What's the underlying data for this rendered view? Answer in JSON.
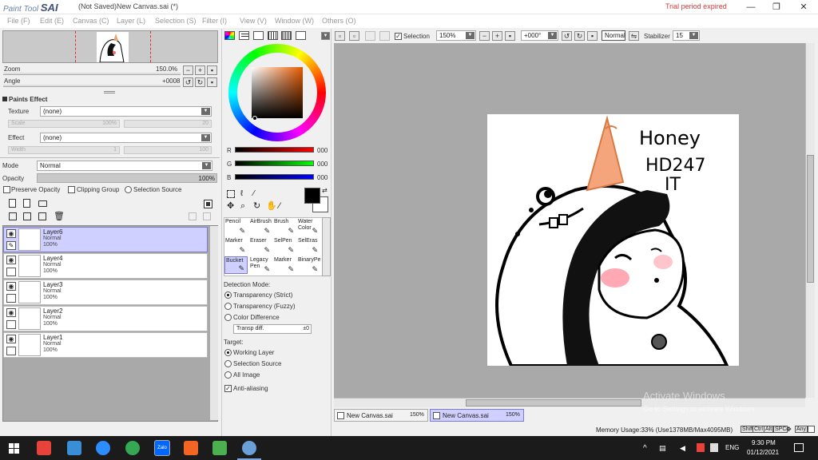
{
  "app": {
    "logo_small": "Paint Tool",
    "logo_big": "SAI",
    "title": "(Not Saved)New Canvas.sai (*)",
    "trial": "Trial period expired"
  },
  "window_controls": [
    "—",
    "❐",
    "✕"
  ],
  "menu": [
    "File (F)",
    "Edit (E)",
    "Canvas (C)",
    "Layer (L)",
    "Selection (S)",
    "Filter (I)",
    "View (V)",
    "Window (W)",
    "Others (O)"
  ],
  "navigator": {
    "zoom_label": "Zoom",
    "zoom_value": "150.0%",
    "angle_label": "Angle",
    "angle_value": "+0008"
  },
  "paints_effect": {
    "header": "Paints Effect",
    "texture_label": "Texture",
    "texture_value": "(none)",
    "scale_label": "Scale",
    "scale_value": "100%",
    "scale_right": "20",
    "effect_label": "Effect",
    "effect_value": "(none)",
    "width_label": "Width",
    "width_value": "1",
    "width_right": "100"
  },
  "layer_props": {
    "mode_label": "Mode",
    "mode_value": "Normal",
    "opacity_label": "Opacity",
    "opacity_value": "100%",
    "opacity_level": 1.0,
    "preserve_opacity": "Preserve Opacity",
    "clipping_group": "Clipping Group",
    "selection_source": "Selection Source"
  },
  "layers": [
    {
      "name": "Layer6",
      "mode": "Normal",
      "opacity": "100%",
      "selected": true
    },
    {
      "name": "Layer4",
      "mode": "Normal",
      "opacity": "100%",
      "selected": false
    },
    {
      "name": "Layer3",
      "mode": "Normal",
      "opacity": "100%",
      "selected": false
    },
    {
      "name": "Layer2",
      "mode": "Normal",
      "opacity": "100%",
      "selected": false
    },
    {
      "name": "Layer1",
      "mode": "Normal",
      "opacity": "100%",
      "selected": false
    }
  ],
  "color": {
    "r_label": "R",
    "r_value": "000",
    "g_label": "G",
    "g_value": "000",
    "b_label": "B",
    "b_value": "000",
    "primary": "#000000",
    "secondary": "#ffffff"
  },
  "tools": [
    {
      "label": "Pencil",
      "selected": false
    },
    {
      "label": "AirBrush",
      "selected": false
    },
    {
      "label": "Brush",
      "selected": false
    },
    {
      "label": "Water Color",
      "selected": false
    },
    {
      "label": "Marker",
      "selected": false
    },
    {
      "label": "Eraser",
      "selected": false
    },
    {
      "label": "SelPen",
      "selected": false
    },
    {
      "label": "SelEras",
      "selected": false
    },
    {
      "label": "Bucket",
      "selected": true
    },
    {
      "label": "Legacy Pen",
      "selected": false
    },
    {
      "label": "Marker",
      "selected": false
    },
    {
      "label": "BinaryPe",
      "selected": false
    }
  ],
  "bucket_options": {
    "detection_label": "Detection Mode:",
    "detection_options": [
      "Transparency (Strict)",
      "Transparency (Fuzzy)",
      "Color Difference"
    ],
    "detection_selected": 0,
    "transp_label": "Transp diff.",
    "transp_value": "±0",
    "target_label": "Target:",
    "target_options": [
      "Working Layer",
      "Selection Source",
      "All Image"
    ],
    "target_selected": 0,
    "antialias_label": "Anti-aliasing",
    "antialias_checked": true
  },
  "toolbar": {
    "selection_label": "Selection",
    "selection_checked": true,
    "zoom_value": "150%",
    "angle_value": "+000°",
    "mode_value": "Normal",
    "stabilizer_label": "Stabilizer",
    "stabilizer_value": "15"
  },
  "artwork_text": {
    "line1": "Honey",
    "line2": "HD247",
    "line3": "IT"
  },
  "tabs": [
    {
      "name": "New Canvas.sai",
      "zoom": "150%",
      "active": false
    },
    {
      "name": "New Canvas.sai",
      "zoom": "150%",
      "active": true
    }
  ],
  "watermark": {
    "line1": "Activate Windows",
    "line2": "Go to Settings to activate Windows."
  },
  "statusbar": {
    "memory": "Memory Usage:33% (Use1378MB/Max4095MB)",
    "keys": [
      "Shift",
      "Ctrl",
      "Alt",
      "SPC",
      "Any"
    ]
  },
  "taskbar": {
    "lang": "ENG",
    "time": "9:30 PM",
    "date": "01/12/2021",
    "zalo_label": "Zalo",
    "apps": [
      {
        "name": "windows-start",
        "color": "#ffffff"
      },
      {
        "name": "app-grid",
        "color": "#e8433b"
      },
      {
        "name": "app-laptop",
        "color": "#3a8ed6"
      },
      {
        "name": "zoom",
        "color": "#2d8cff"
      },
      {
        "name": "chrome",
        "color": "#35a853"
      },
      {
        "name": "zalo",
        "color": "#0068ff"
      },
      {
        "name": "avast",
        "color": "#f26522"
      },
      {
        "name": "game",
        "color": "#4caf50"
      },
      {
        "name": "paint-tool-sai",
        "color": "#6aa0d8"
      }
    ]
  }
}
